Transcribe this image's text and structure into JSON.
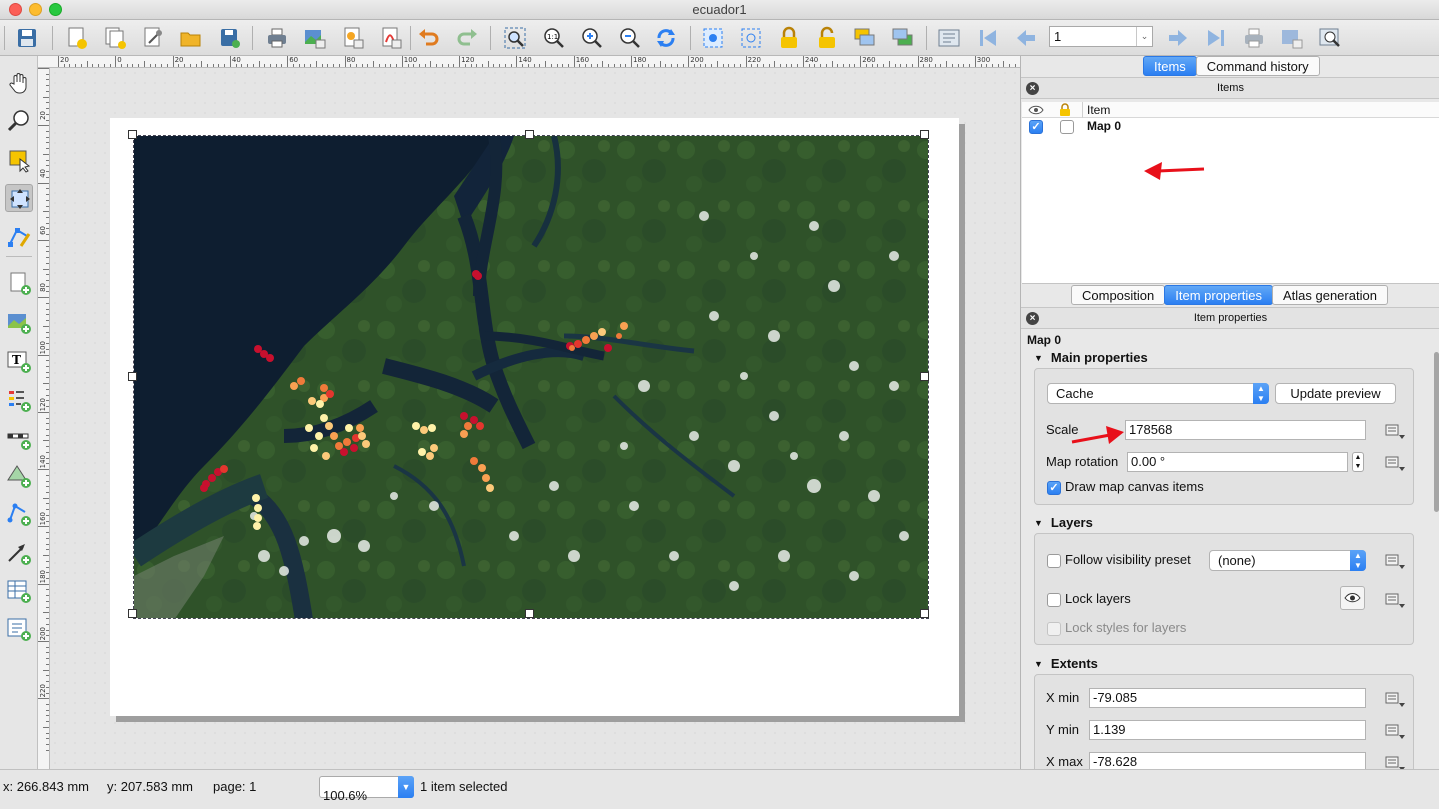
{
  "window": {
    "title": "ecuador1"
  },
  "toolbar": {
    "page_value": "1",
    "icons": [
      "save-icon",
      "new-composition-icon",
      "duplicate-composition-icon",
      "composition-manager-icon",
      "open-template-icon",
      "save-template-icon",
      "print-icon",
      "export-image-icon",
      "export-svg-icon",
      "export-pdf-icon",
      "export-pdf-settings-icon",
      "undo-icon",
      "redo-icon",
      "zoom-full-icon",
      "zoom-actual-icon",
      "zoom-in-icon",
      "zoom-out-icon",
      "refresh-icon",
      "select-all-icon",
      "deselect-icon",
      "lock-icon",
      "unlock-icon",
      "raise-items-icon",
      "lower-items-icon",
      "atlas-preview-icon",
      "first-feature-icon",
      "previous-feature-icon",
      "next-feature-icon",
      "last-feature-icon",
      "atlas-print-icon",
      "atlas-export-icon",
      "atlas-settings-icon"
    ]
  },
  "left_tools": [
    "pan-icon",
    "zoom-tool-icon",
    "select-move-icon",
    "move-content-icon",
    "edit-nodes-icon",
    "add-map-icon",
    "add-image-icon",
    "add-label-icon",
    "add-legend-icon",
    "add-scalebar-icon",
    "add-shape-icon",
    "add-nodes-icon",
    "add-arrow-icon",
    "add-table-icon",
    "add-html-icon"
  ],
  "rulers": {
    "h_labels": [
      "20",
      "0",
      "20",
      "40",
      "60",
      "80",
      "100",
      "120",
      "140",
      "160",
      "180",
      "200",
      "220",
      "240",
      "260",
      "280",
      "300"
    ],
    "v_labels": [
      "20",
      "40",
      "60",
      "80",
      "100",
      "120",
      "140",
      "160",
      "180",
      "200",
      "220"
    ]
  },
  "items_panel": {
    "tabs": [
      "Items",
      "Command history"
    ],
    "header": "Items",
    "column_item": "Item",
    "rows": [
      {
        "name": "Map 0",
        "visible": true,
        "locked": false
      }
    ]
  },
  "props_panel": {
    "tabs": [
      "Composition",
      "Item properties",
      "Atlas generation"
    ],
    "header": "Item properties",
    "item_name": "Map 0",
    "main_properties": {
      "title": "Main properties",
      "cache_mode": "Cache",
      "update_preview": "Update preview",
      "scale_label": "Scale",
      "scale_value": "178568",
      "rotation_label": "Map rotation",
      "rotation_value": "0.00 °",
      "draw_canvas_items": "Draw map canvas items"
    },
    "layers": {
      "title": "Layers",
      "follow_preset": "Follow visibility preset",
      "preset_value": "(none)",
      "lock_layers": "Lock layers",
      "lock_styles": "Lock styles for layers"
    },
    "extents": {
      "title": "Extents",
      "xmin_label": "X min",
      "xmin_value": "-79.085",
      "ymin_label": "Y min",
      "ymin_value": "1.139",
      "xmax_label": "X max",
      "xmax_value": "-78.628"
    }
  },
  "statusbar": {
    "x": "x: 266.843 mm",
    "y": "y: 207.583 mm",
    "page": "page: 1",
    "zoom": "100.6%",
    "selection": "1 item selected"
  },
  "colors": {
    "accent": "#2b7ff2",
    "arrow": "#e8101a"
  }
}
